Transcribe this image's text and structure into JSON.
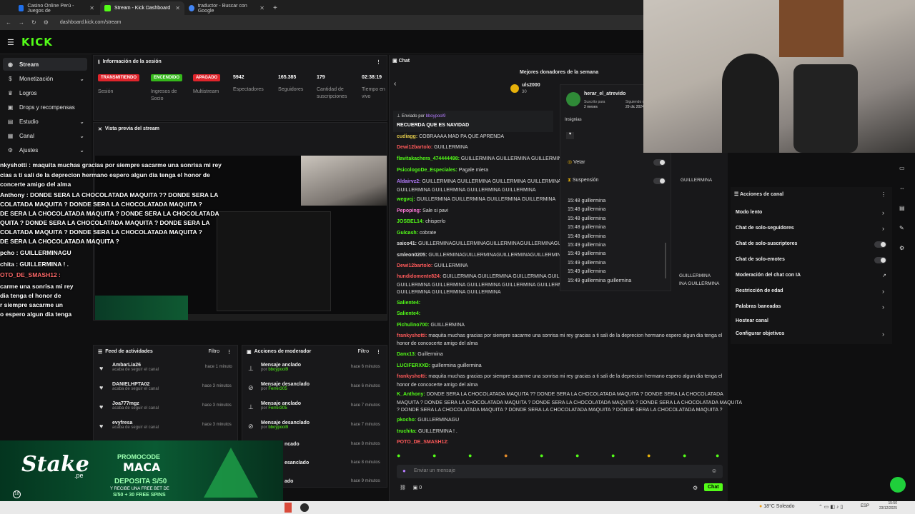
{
  "browser": {
    "tabs": [
      {
        "title": "Casino Online Perú - Juegos de",
        "active": false,
        "color": "#1f6feb"
      },
      {
        "title": "Stream - Kick Dashboard",
        "active": true,
        "color": "#53fc18"
      },
      {
        "title": "traductor - Buscar con Google",
        "active": false,
        "color": "#4285f4"
      }
    ],
    "new_tab": "+",
    "address": "dashboard.kick.com/stream"
  },
  "kick": {
    "logo": "KICK",
    "sidebar": [
      {
        "label": "Stream",
        "icon": "broadcast-icon",
        "active": true,
        "chevron": false
      },
      {
        "label": "Monetización",
        "icon": "money-icon",
        "active": false,
        "chevron": true
      },
      {
        "label": "Logros",
        "icon": "trophy-icon",
        "active": false,
        "chevron": false
      },
      {
        "label": "Drops y recompensas",
        "icon": "gift-icon",
        "active": false,
        "chevron": false
      },
      {
        "label": "Estudio",
        "icon": "studio-icon",
        "active": false,
        "chevron": true
      },
      {
        "label": "Canal",
        "icon": "channel-icon",
        "active": false,
        "chevron": true
      },
      {
        "label": "Ajustes",
        "icon": "gear-icon",
        "active": false,
        "chevron": true
      }
    ],
    "session": {
      "title": "Información de la sesión",
      "badges": [
        {
          "label": "TRANSMITIENDO",
          "sub": "Sesión",
          "color": "#e0242b"
        },
        {
          "label": "ENCENDIDO",
          "sub": "Ingresos de Socio",
          "color": "#35b81b"
        },
        {
          "label": "APAGADO",
          "sub": "Multistream",
          "color": "#e0242b"
        }
      ],
      "stats": [
        {
          "value": "5942",
          "label": "Espectadores"
        },
        {
          "value": "165.385",
          "label": "Seguidores"
        },
        {
          "value": "179",
          "label": "Cantidad de suscripciones"
        },
        {
          "value": "02:38:19",
          "label": "Tiempo en vivo"
        }
      ]
    },
    "preview": {
      "title": "Vista previa del stream"
    },
    "overlay_lines": [
      "nkyshotti : maquita muchas gracias por siempre sacarme una sonrisa mi rey",
      "cias a ti sali de la deprecion hermano espero algun dia tenga el honor de",
      "concerte amigo del alma",
      "Anthony : DONDE SERA LA CHOCOLATADA MAQUITA ?? DONDE SERA LA",
      "COLATADA MAQUITA ? DONDE SERA LA CHOCOLATADA MAQUITA ?",
      "DE SERA LA CHOCOLATADA MAQUITA ? DONDE SERA LA CHOCOLATADA",
      "QUITA ? DONDE SERA LA CHOCOLATADA MAQUITA ? DONDE SERA LA",
      "COLATADA MAQUITA ? DONDE SERA LA CHOCOLATADA MAQUITA ?",
      "DE SERA LA CHOCOLATADA MAQUITA ?",
      "pcho : GUILLERMINAGU",
      "chita : GUILLERMINA ! .",
      "OTO_DE_SMASH12 :",
      "carme una sonrisa mi rey",
      "dia tenga el honor de",
      "r siempre sacarme un",
      "o espero algun dia tenga"
    ],
    "feed": {
      "title": "Feed de actividades",
      "filter": "Filtro",
      "items": [
        {
          "name": "AmbarLia26",
          "sub": "acaba de seguir el canal",
          "time": "hace 1 minuto"
        },
        {
          "name": "DANIELHPTA02",
          "sub": "acaba de seguir el canal",
          "time": "hace 3 minutos"
        },
        {
          "name": "Joa777mgz",
          "sub": "acaba de seguir el canal",
          "time": "hace 3 minutos"
        },
        {
          "name": "evyfresa",
          "sub": "acaba de seguir el canal",
          "time": "hace 3 minutos"
        }
      ]
    },
    "modactions": {
      "title": "Acciones de moderador",
      "filter": "Filtro",
      "items": [
        {
          "name": "Mensaje anclado",
          "by": "bboypool9",
          "time": "hace 6 minutos"
        },
        {
          "name": "Mensaje desanclado",
          "by": "Ferrer305",
          "time": "hace 6 minutos"
        },
        {
          "name": "Mensaje anclado",
          "by": "Ferrer305",
          "time": "hace 7 minutos"
        },
        {
          "name": "Mensaje desanclado",
          "by": "bboypool9",
          "time": "hace 7 minutos"
        },
        {
          "name": "ncado",
          "by": "",
          "time": "hace 8 minutos"
        },
        {
          "name": "esanclado",
          "by": "",
          "time": "hace 8 minutos"
        },
        {
          "name": "ado",
          "by": "",
          "time": "hace 9 minutos"
        }
      ]
    },
    "chat": {
      "title": "Chat",
      "donors_title": "Mejores donadores de la semana",
      "donor": {
        "name": "uls2000",
        "amount": "30"
      },
      "pinned_by": "Enviado por",
      "pinned_user": "bboypool9",
      "pinned_text": "RECUERDA QUE ES NAVIDAD",
      "lines": [
        {
          "user": "cudiagg:",
          "text": "COBRAAAA MAD PA QUE APRENDA",
          "color": "#e0c84a"
        },
        {
          "user": "Dewi12bartolo:",
          "text": "GUILLERMINA",
          "color": "#ff5a5a"
        },
        {
          "user": "flavitakachera_474444498:",
          "text": "GUILLERMINA GUILLERMINA GUILLERMINA GUILLERMINA",
          "color": "#53fc18"
        },
        {
          "user": "PsicologoDe_Especiales:",
          "text": "Pagale miera",
          "color": "#53fc18"
        },
        {
          "user": "Aldairvz2:",
          "text": "GUILLERMINA GUILLERMINA GUILLERMINA GUILLERMINA GUILLERMINA GUILLERMINA",
          "color": "#b57cff"
        },
        {
          "user": "",
          "text": "GUILLERMINA GUILLERMINA GUILLERMINA GUILLERMINA",
          "color": "#dddddd"
        },
        {
          "user": "wegvcj:",
          "text": "GUILLERMINA GUILLERMINA GUILLERMINA GUILLERMINA",
          "color": "#53fc18"
        },
        {
          "user": "Pepoping:",
          "text": "Sale si pavi",
          "color": "#ff7ad9"
        },
        {
          "user": "JOSBEL14:",
          "text": "chisperlo",
          "color": "#53fc18"
        },
        {
          "user": "Gulcash:",
          "text": "cobrate",
          "color": "#53fc18"
        },
        {
          "user": "saico41:",
          "text": "GUILLERMINAGUILLERMINAGUILLERMINAGUILLERMINAGUILLERMINAGUIL",
          "color": "#dddddd"
        },
        {
          "user": "smleon0205:",
          "text": "GUILLERMINAGUILLERMINAGUILLERMINAGUILLERMINAGUILLERMINAGUIL",
          "color": "#dddddd"
        },
        {
          "user": "Dewi12bartolo:",
          "text": "GUILLERMINA",
          "color": "#ff5a5a"
        },
        {
          "user": "hundidomente824:",
          "text": "GUILLERMINA GUILLERMINA GUILLERMINA GUILLERMINA GUILLERMINA",
          "color": "#ff5a5a"
        },
        {
          "user": "",
          "text": "GUILLERMINA GUILLERMINA GUILLERMINA GUILLERMINA GUILLERMINA",
          "color": "#dddddd"
        },
        {
          "user": "",
          "text": "GUILLERMINA GUILLERMINA GUILLERMINA",
          "color": "#dddddd"
        },
        {
          "user": "Saliente4:",
          "text": "",
          "color": "#53fc18"
        },
        {
          "user": "Saliente4:",
          "text": "",
          "color": "#53fc18"
        },
        {
          "user": "Pichulino700:",
          "text": "GUILLERMINA",
          "color": "#53fc18"
        },
        {
          "user": "frankyshotti:",
          "text": "maquita muchas gracias por siempre sacarme una sonrisa mi rey gracias a ti sali de la deprecion hermano espero algun dia tenga el",
          "color": "#ff5a5a"
        },
        {
          "user": "",
          "text": "honor de concocerte amigo del alma",
          "color": "#dddddd"
        },
        {
          "user": "Danx13:",
          "text": "Guillermina",
          "color": "#53fc18"
        },
        {
          "user": "LUCIFERXXD:",
          "text": "guillermina guillermina",
          "color": "#53fc18"
        },
        {
          "user": "frankyshotti:",
          "text": "maquita muchas gracias por siempre sacarme una sonrisa mi rey gracias a ti sali de la deprecion hermano espero algun dia tenga el",
          "color": "#ff5a5a"
        },
        {
          "user": "",
          "text": "honor de concocerte amigo del alma",
          "color": "#dddddd"
        },
        {
          "user": "K_Anthony:",
          "text": "DONDE SERA LA CHOCOLATADA MAQUITA ?? DONDE SERA LA CHOCOLATADA MAQUITA ? DONDE SERA LA CHOCOLATADA",
          "color": "#53fc18"
        },
        {
          "user": "",
          "text": "MAQUITA ? DONDE SERA LA CHOCOLATADA MAQUITA ? DONDE SERA LA CHOCOLATADA MAQUITA ? DONDE SERA LA CHOCOLATADA MAQUITA",
          "color": "#dddddd"
        },
        {
          "user": "",
          "text": "? DONDE SERA LA CHOCOLATADA MAQUITA ? DONDE SERA LA CHOCOLATADA MAQUITA ? DONDE SERA LA CHOCOLATADA MAQUITA ?",
          "color": "#dddddd"
        },
        {
          "user": "pkocho:",
          "text": "GUILLERMINAGU",
          "color": "#53fc18"
        },
        {
          "user": "truchita:",
          "text": "GUILLERMINA ! .",
          "color": "#53fc18"
        },
        {
          "user": "POTO_DE_SMASH12:",
          "text": "",
          "color": "#ff5a5a"
        }
      ],
      "input_placeholder": "Enviar un mensaje",
      "send_label": "Chat",
      "bottom_count": "0"
    },
    "user_card": {
      "name": "herar_el_atrevido",
      "sub_label": "Suscrito para",
      "sub_value": "2 meses",
      "follow_label": "Siguiendo desde",
      "follow_value": "29 dic 2024",
      "badges_label": "Insignias",
      "vetar": "Vetar",
      "suspension": "Suspensión",
      "times": [
        "15:48 guillermina",
        "15:48 guillermina",
        "15:48 guillermina",
        "15:48 guillermina",
        "15:48 guillermina",
        "15:49 guillermina",
        "15:49 guillermina",
        "15:49 guillermina",
        "15:49 guillermina",
        "15:49 guillermina guillermina"
      ]
    },
    "channel_actions": {
      "title": "Acciones de canal",
      "items": [
        {
          "label": "Modo lento",
          "kind": "arrow"
        },
        {
          "label": "Chat de solo-seguidores",
          "kind": "arrow"
        },
        {
          "label": "Chat de solo-suscriptores",
          "kind": "toggle"
        },
        {
          "label": "Chat de solo-emotes",
          "kind": "toggle"
        },
        {
          "label": "Moderación del chat con IA",
          "kind": "external"
        },
        {
          "label": "Restricción de edad",
          "kind": "arrow"
        },
        {
          "label": "Palabras baneadas",
          "kind": "arrow"
        },
        {
          "label": "Hostear canal",
          "kind": "none"
        },
        {
          "label": "Configurar objetivos",
          "kind": "arrow"
        }
      ],
      "side_peek": [
        "GUILLERMINA",
        "GUILLERMINA",
        "INA GUILLERMINA"
      ]
    }
  },
  "promo": {
    "brand": "Stake",
    "brand_sub": ".pe",
    "code_label": "PROMOCODE",
    "code": "MACA",
    "deposit": "DEPOSITA S/50",
    "bonus": "Y RECIBE UNA FREE BET DE",
    "bonus2": "S/50 + 30 FREE SPINS",
    "age": "18"
  },
  "taskbar": {
    "weather": "18°C  Soleado",
    "lang": "ESP",
    "time": "15:50",
    "date": "23/12/2025"
  }
}
